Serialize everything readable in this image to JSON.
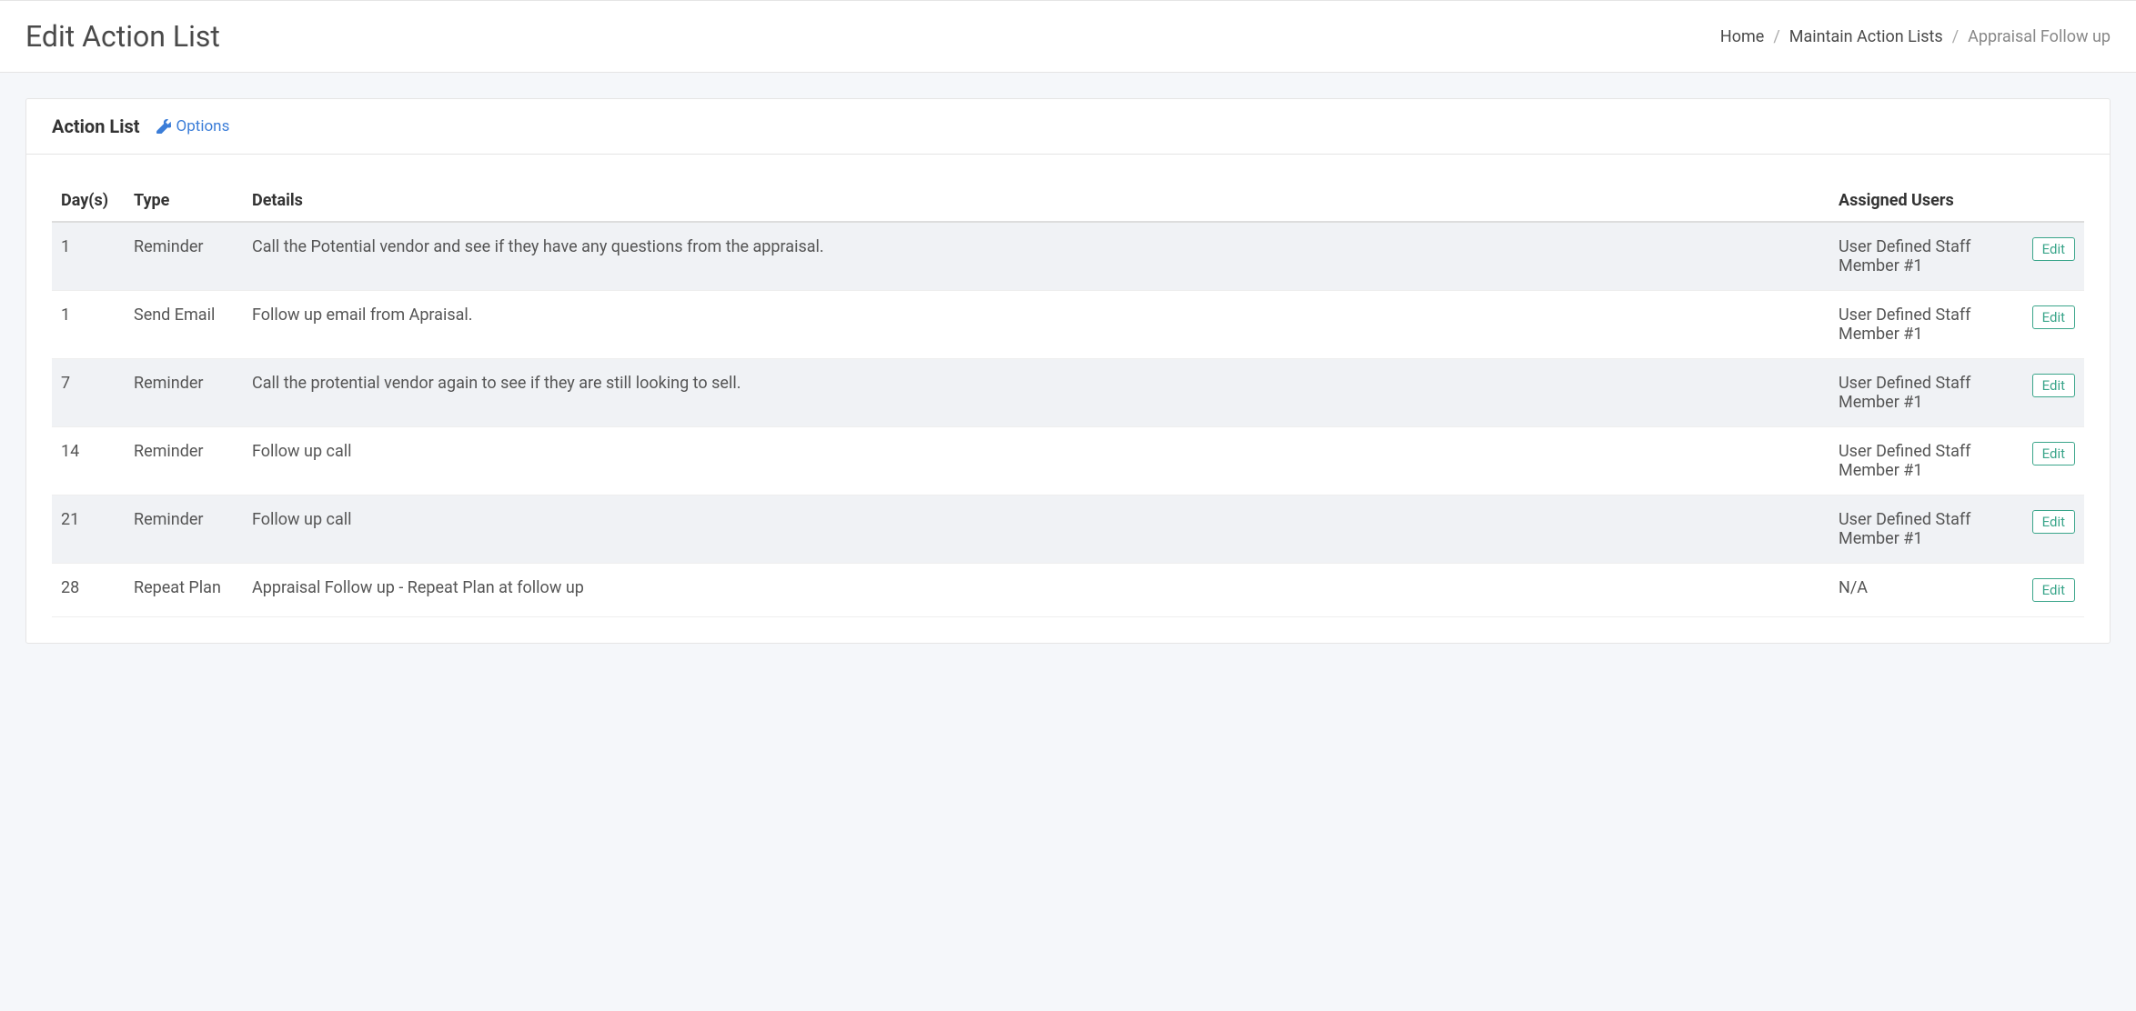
{
  "header": {
    "title": "Edit Action List",
    "breadcrumb": {
      "home": "Home",
      "maintain": "Maintain Action Lists",
      "current": "Appraisal Follow up"
    }
  },
  "panel": {
    "title": "Action List",
    "options_label": "Options"
  },
  "table": {
    "headers": {
      "days": "Day(s)",
      "type": "Type",
      "details": "Details",
      "assigned": "Assigned Users"
    },
    "edit_label": "Edit",
    "rows": [
      {
        "days": "1",
        "type": "Reminder",
        "details": "Call the Potential vendor and see if they have any questions from the appraisal.",
        "assigned": "User Defined Staff Member #1"
      },
      {
        "days": "1",
        "type": "Send Email",
        "details": "Follow up email from Apraisal.",
        "assigned": "User Defined Staff Member #1"
      },
      {
        "days": "7",
        "type": "Reminder",
        "details": "Call the protential vendor again to see if they are still looking to sell.",
        "assigned": "User Defined Staff Member #1"
      },
      {
        "days": "14",
        "type": "Reminder",
        "details": "Follow up call",
        "assigned": "User Defined Staff Member #1"
      },
      {
        "days": "21",
        "type": "Reminder",
        "details": "Follow up call",
        "assigned": "User Defined Staff Member #1"
      },
      {
        "days": "28",
        "type": "Repeat Plan",
        "details": "Appraisal Follow up - Repeat Plan at follow up",
        "assigned": "N/A"
      }
    ]
  }
}
